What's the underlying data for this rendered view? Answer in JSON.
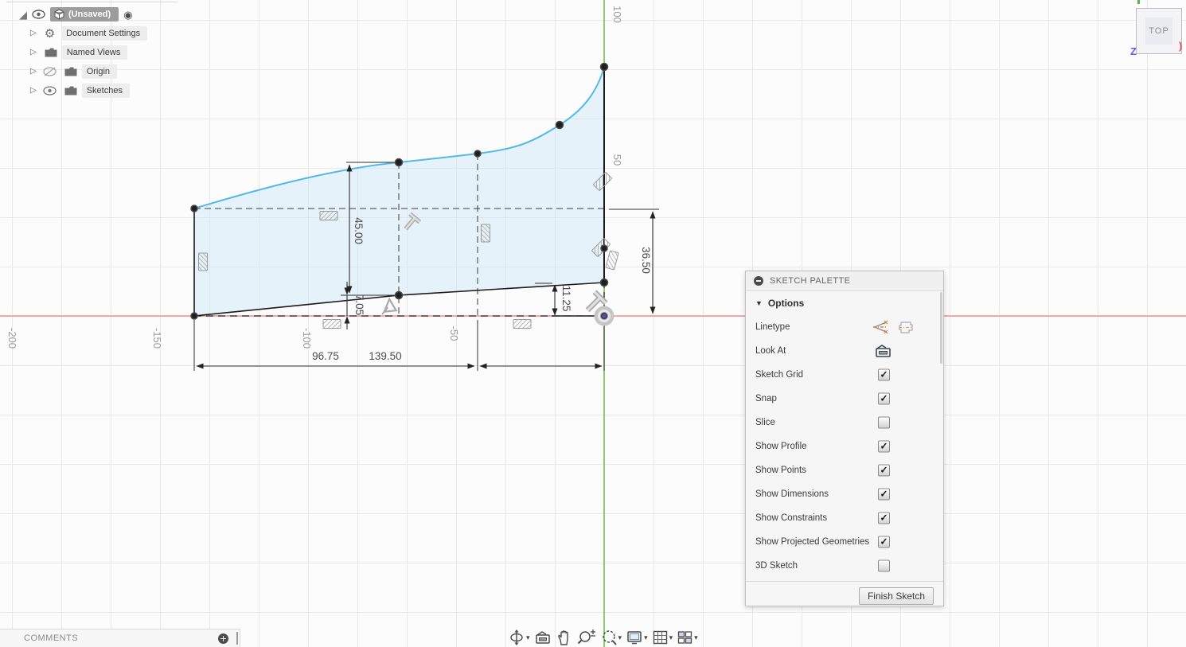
{
  "browser": {
    "root_label": "(Unsaved)",
    "items": [
      "Document Settings",
      "Named Views",
      "Origin",
      "Sketches"
    ]
  },
  "viewcube": {
    "face_label": "TOP",
    "axis_z": "Z",
    "axis_x_glyph": ")"
  },
  "sketch": {
    "dimensions": {
      "spline_height": "45.00",
      "small_height": "7.05",
      "right_bottom_height": "11.25",
      "mid_height": "36.50",
      "width_left": "96.75",
      "width_total": "139.50"
    },
    "axis_x_labels": [
      "-200",
      "-150",
      "-100",
      "-50"
    ],
    "axis_y_labels": [
      "100",
      "50"
    ],
    "colors": {
      "x_axis": "#ef8f88",
      "y_axis": "#6cbe45",
      "spline": "#55b9e8",
      "profile_fill": "#cfe7f6",
      "origin_center": "#5b4fa8"
    }
  },
  "palette": {
    "title": "SKETCH PALETTE",
    "section": "Options",
    "rows": [
      {
        "label": "Linetype",
        "control": "linetype-icons"
      },
      {
        "label": "Look At",
        "control": "look-at-icon"
      },
      {
        "label": "Sketch Grid",
        "checked": true
      },
      {
        "label": "Snap",
        "checked": true
      },
      {
        "label": "Slice",
        "checked": false
      },
      {
        "label": "Show Profile",
        "checked": true
      },
      {
        "label": "Show Points",
        "checked": true
      },
      {
        "label": "Show Dimensions",
        "checked": true
      },
      {
        "label": "Show Constraints",
        "checked": true
      },
      {
        "label": "Show Projected Geometries",
        "checked": true
      },
      {
        "label": "3D Sketch",
        "checked": false
      }
    ],
    "finish_button": "Finish Sketch"
  },
  "comments": {
    "label": "COMMENTS"
  },
  "toolbar": {
    "buttons": [
      "orbit",
      "look-at",
      "pan",
      "zoom",
      "zoom-window",
      "display-settings",
      "grid-settings",
      "viewports"
    ]
  }
}
